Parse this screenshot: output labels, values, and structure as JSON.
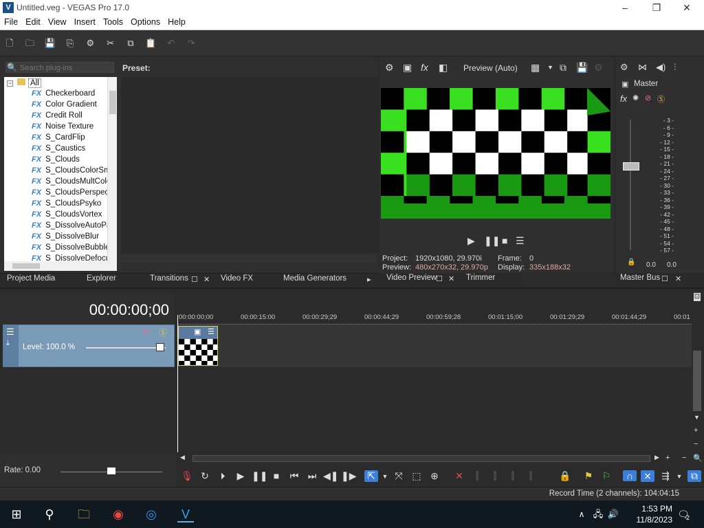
{
  "window": {
    "title": "Untitled.veg - VEGAS Pro 17.0",
    "app_icon": "V",
    "controls": [
      "–",
      "❐",
      "✕"
    ]
  },
  "menu": [
    "File",
    "Edit",
    "View",
    "Insert",
    "Tools",
    "Options",
    "Help"
  ],
  "plugins": {
    "search_placeholder": "Search plug-ins",
    "preset_label": "Preset:",
    "root": "All",
    "fx_tag": "FX",
    "items": [
      "Checkerboard",
      "Color Gradient",
      "Credit Roll",
      "Noise Texture",
      "S_CardFlip",
      "S_Caustics",
      "S_Clouds",
      "S_CloudsColorSmo",
      "S_CloudsMultColo",
      "S_CloudsPerspect",
      "S_CloudsPsyko",
      "S_CloudsVortex",
      "S_DissolveAutoPa",
      "S_DissolveBlur",
      "S_DissolveBubble",
      "S_DissolveDefocu"
    ]
  },
  "left_tabs": [
    "Project Media",
    "Explorer",
    "Transitions",
    "Video FX",
    "Media Generators"
  ],
  "preview": {
    "mode": "Preview (Auto)",
    "project_label": "Project:",
    "project_value": "1920x1080, 29.970i",
    "frame_label": "Frame:",
    "frame_value": "0",
    "preview_label": "Preview:",
    "preview_value": "480x270x32, 29.970p",
    "display_label": "Display:",
    "display_value": "335x188x32",
    "tabs": [
      "Video Preview",
      "Trimmer"
    ]
  },
  "master": {
    "label": "Master",
    "tab": "Master Bus",
    "meter_marks": [
      "3",
      "6",
      "9",
      "12",
      "15",
      "18",
      "21",
      "24",
      "27",
      "30",
      "33",
      "36",
      "39",
      "42",
      "45",
      "48",
      "51",
      "54",
      "57"
    ],
    "left_value": "0.0",
    "right_value": "0.0"
  },
  "timeline": {
    "timecode": "00:00:00;00",
    "track_level": "Level: 100.0 %",
    "ruler": [
      "00:00:00;00",
      "00:00:15:00",
      "00:00:29;29",
      "00:00:44;29",
      "00:00:59;28",
      "00:01:15;00",
      "00:01:29;29",
      "00:01:44;29",
      "00:01"
    ],
    "rate": "Rate: 0.00"
  },
  "status": {
    "record_time": "Record Time (2 channels): 104:04:15"
  },
  "taskbar": {
    "time": "1:53 PM",
    "date": "11/8/2023",
    "notifications": "2"
  },
  "colors": {
    "checker_green": "#39e01f",
    "checker_dark_green": "#1a9a12",
    "accent_blue": "#3b7fd8"
  }
}
